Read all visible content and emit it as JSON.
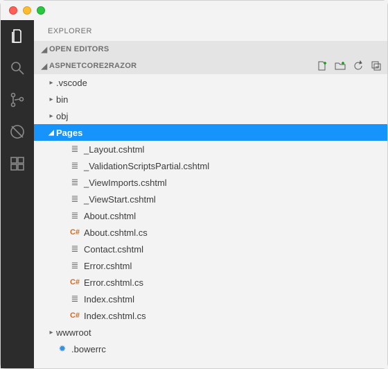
{
  "titlebar": {
    "close": "",
    "min": "",
    "max": ""
  },
  "activitybar": {
    "explorer": "Explorer",
    "search": "Search",
    "scm": "Source Control",
    "debug": "Debug",
    "extensions": "Extensions"
  },
  "sidebar": {
    "title": "EXPLORER",
    "sections": {
      "open_editors": "OPEN EDITORS",
      "project": "ASPNETCORE2RAZOR"
    },
    "actions": {
      "new_file": "New File",
      "new_folder": "New Folder",
      "refresh": "Refresh",
      "collapse": "Collapse All"
    },
    "tree": [
      {
        "name": ".vscode",
        "type": "folder",
        "depth": 1,
        "expanded": false
      },
      {
        "name": "bin",
        "type": "folder",
        "depth": 1,
        "expanded": false
      },
      {
        "name": "obj",
        "type": "folder",
        "depth": 1,
        "expanded": false
      },
      {
        "name": "Pages",
        "type": "folder",
        "depth": 1,
        "expanded": true,
        "selected": true
      },
      {
        "name": "_Layout.cshtml",
        "type": "file",
        "icon": "file",
        "depth": 2
      },
      {
        "name": "_ValidationScriptsPartial.cshtml",
        "type": "file",
        "icon": "file",
        "depth": 2
      },
      {
        "name": "_ViewImports.cshtml",
        "type": "file",
        "icon": "file",
        "depth": 2
      },
      {
        "name": "_ViewStart.cshtml",
        "type": "file",
        "icon": "file",
        "depth": 2
      },
      {
        "name": "About.cshtml",
        "type": "file",
        "icon": "file",
        "depth": 2
      },
      {
        "name": "About.cshtml.cs",
        "type": "file",
        "icon": "cs",
        "depth": 2
      },
      {
        "name": "Contact.cshtml",
        "type": "file",
        "icon": "file",
        "depth": 2
      },
      {
        "name": "Error.cshtml",
        "type": "file",
        "icon": "file",
        "depth": 2
      },
      {
        "name": "Error.cshtml.cs",
        "type": "file",
        "icon": "cs",
        "depth": 2
      },
      {
        "name": "Index.cshtml",
        "type": "file",
        "icon": "file",
        "depth": 2
      },
      {
        "name": "Index.cshtml.cs",
        "type": "file",
        "icon": "cs",
        "depth": 2
      },
      {
        "name": "wwwroot",
        "type": "folder",
        "depth": 1,
        "expanded": false
      },
      {
        "name": ".bowerrc",
        "type": "file",
        "icon": "bower",
        "depth": 1
      }
    ]
  }
}
